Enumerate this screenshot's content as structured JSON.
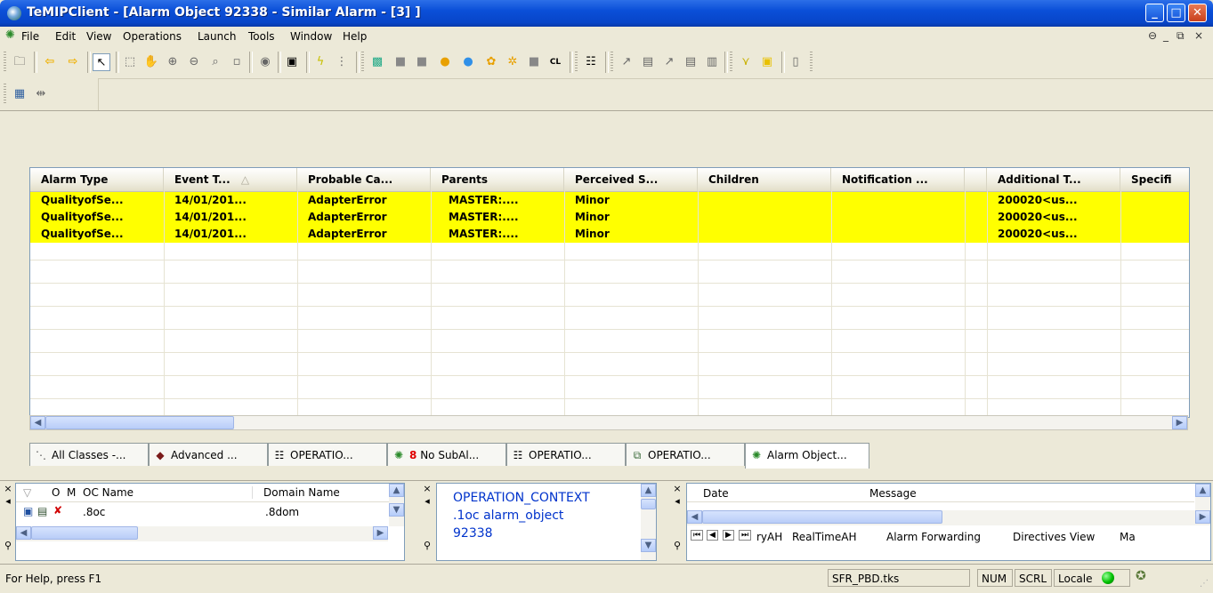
{
  "window": {
    "title": "TeMIPClient - [Alarm Object 92338 - Similar Alarm - [3] ]",
    "minimize": "_",
    "maximize": "□",
    "close": "✕"
  },
  "menu": {
    "items": [
      "File",
      "Edit",
      "View",
      "Operations",
      "Launch",
      "Tools",
      "Window",
      "Help"
    ],
    "mdi_controls": [
      "⊖",
      "_",
      "⧉",
      "×"
    ]
  },
  "grid": {
    "columns": [
      "Alarm Type",
      "Event T...",
      "Probable Ca...",
      "Parents",
      "Perceived S...",
      "Children",
      "Notification ...",
      "Additional T...",
      "Specifi"
    ],
    "rows": [
      [
        "QualityofSe...",
        "14/01/201...",
        "AdapterError",
        "MASTER:....",
        "Minor",
        "",
        "",
        "200020<us...",
        ""
      ],
      [
        "QualityofSe...",
        "14/01/201...",
        "AdapterError",
        "MASTER:....",
        "Minor",
        "",
        "",
        "200020<us...",
        ""
      ],
      [
        "QualityofSe...",
        "14/01/201...",
        "AdapterError",
        "MASTER:....",
        "Minor",
        "",
        "",
        "200020<us...",
        ""
      ]
    ],
    "row_color": "#ffff00",
    "sort_indicator": "△"
  },
  "tabs": [
    {
      "label": "All Classes -...",
      "icon": "classes-icon"
    },
    {
      "label": "Advanced ...",
      "icon": "book-icon"
    },
    {
      "label": "OPERATIO...",
      "icon": "properties-icon"
    },
    {
      "label": "No SubAl...",
      "count": "8",
      "icon": "bulb-icon"
    },
    {
      "label": "OPERATIO...",
      "icon": "properties-icon"
    },
    {
      "label": "OPERATIO...",
      "icon": "network-icon"
    },
    {
      "label": "Alarm Object...",
      "icon": "bulb-icon"
    }
  ],
  "oc_panel": {
    "col_o": "O",
    "col_m": "M",
    "col_oc_name": "OC Name",
    "col_domain": "Domain Name",
    "oc_value": ".8oc",
    "domain_value": ".8dom"
  },
  "context_panel": {
    "line1": "OPERATION_CONTEXT",
    "line2": ".1oc alarm_object",
    "line3": "92338"
  },
  "log_panel": {
    "col_date": "Date",
    "col_message": "Message",
    "tabs": [
      "ryAH",
      "RealTimeAH",
      "Alarm Forwarding",
      "Directives View",
      "Ma"
    ]
  },
  "status": {
    "help": "For Help, press F1",
    "file": "SFR_PBD.tks",
    "num": "NUM",
    "scrl": "SCRL",
    "locale": "Locale"
  },
  "colors": {
    "titlebar": "#0a4fd8",
    "alarm_minor": "#ffff00",
    "context_text": "#0033cc",
    "status_green": "#00c000"
  }
}
